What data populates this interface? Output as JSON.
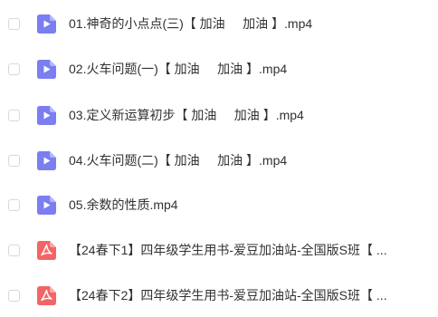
{
  "files": [
    {
      "name": "01.神奇的小点点(三)【 加油     加油 】.mp4",
      "icon": "video-file-icon"
    },
    {
      "name": "02.火车问题(一)【 加油     加油 】.mp4",
      "icon": "video-file-icon"
    },
    {
      "name": "03.定义新运算初步【 加油     加油 】.mp4",
      "icon": "video-file-icon"
    },
    {
      "name": "04.火车问题(二)【 加油     加油 】.mp4",
      "icon": "video-file-icon"
    },
    {
      "name": "05.余数的性质.mp4",
      "icon": "video-file-icon"
    },
    {
      "name": "【24春下1】四年级学生用书-爱豆加油站-全国版S班【 ...",
      "icon": "pdf-file-icon"
    },
    {
      "name": "【24春下2】四年级学生用书-爱豆加油站-全国版S班【 ...",
      "icon": "pdf-file-icon"
    }
  ],
  "colors": {
    "video_icon": "#7a7ef0",
    "pdf_icon": "#f26565",
    "text": "#303133",
    "checkbox_border": "#d6d9de"
  }
}
